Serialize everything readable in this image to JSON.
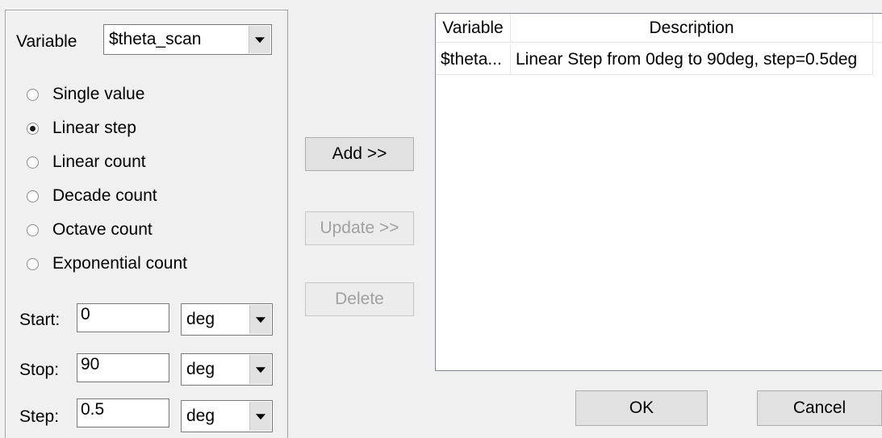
{
  "variable": {
    "label": "Variable",
    "selected": "$theta_scan"
  },
  "scan_modes": [
    {
      "label": "Single value",
      "selected": false
    },
    {
      "label": "Linear step",
      "selected": true
    },
    {
      "label": "Linear count",
      "selected": false
    },
    {
      "label": "Decade count",
      "selected": false
    },
    {
      "label": "Octave count",
      "selected": false
    },
    {
      "label": "Exponential count",
      "selected": false
    }
  ],
  "params": {
    "start": {
      "label": "Start:",
      "value": "0",
      "unit": "deg"
    },
    "stop": {
      "label": "Stop:",
      "value": "90",
      "unit": "deg"
    },
    "step": {
      "label": "Step:",
      "value": "0.5",
      "unit": "deg"
    }
  },
  "buttons": {
    "add": "Add >>",
    "update": "Update >>",
    "delete": "Delete",
    "ok": "OK",
    "cancel": "Cancel"
  },
  "table": {
    "columns": [
      "Variable",
      "Description"
    ],
    "rows": [
      {
        "variable": "$theta...",
        "description": "Linear Step from 0deg to 90deg, step=0.5deg"
      }
    ]
  }
}
